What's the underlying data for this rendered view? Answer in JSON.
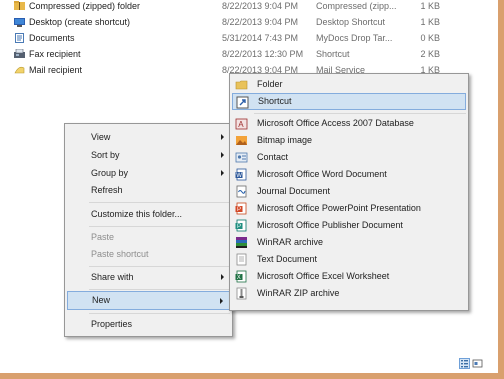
{
  "files": [
    {
      "name": "Compressed (zipped) folder",
      "date": "8/22/2013 9:04 PM",
      "type": "Compressed (zipp...",
      "size": "1 KB",
      "icon": "zip-folder-icon"
    },
    {
      "name": "Desktop (create shortcut)",
      "date": "8/22/2013 9:04 PM",
      "type": "Desktop Shortcut",
      "size": "1 KB",
      "icon": "desktop-icon"
    },
    {
      "name": "Documents",
      "date": "5/31/2014 7:43 PM",
      "type": "MyDocs Drop Tar...",
      "size": "0 KB",
      "icon": "document-icon"
    },
    {
      "name": "Fax recipient",
      "date": "8/22/2013 12:30 PM",
      "type": "Shortcut",
      "size": "2 KB",
      "icon": "fax-icon"
    },
    {
      "name": "Mail recipient",
      "date": "8/22/2013 9:04 PM",
      "type": "Mail Service",
      "size": "1 KB",
      "icon": "mail-icon"
    }
  ],
  "context_menu": {
    "view": "View",
    "sort_by": "Sort by",
    "group_by": "Group by",
    "refresh": "Refresh",
    "customize": "Customize this folder...",
    "paste": "Paste",
    "paste_shortcut": "Paste shortcut",
    "share_with": "Share with",
    "new": "New",
    "properties": "Properties"
  },
  "new_submenu": [
    {
      "label": "Folder",
      "icon": "folder-icon"
    },
    {
      "label": "Shortcut",
      "icon": "shortcut-icon"
    },
    {
      "label": "Microsoft Office Access 2007 Database",
      "icon": "access-icon"
    },
    {
      "label": "Bitmap image",
      "icon": "bitmap-icon"
    },
    {
      "label": "Contact",
      "icon": "contact-icon"
    },
    {
      "label": "Microsoft Office Word Document",
      "icon": "word-icon"
    },
    {
      "label": "Journal Document",
      "icon": "journal-icon"
    },
    {
      "label": "Microsoft Office PowerPoint Presentation",
      "icon": "powerpoint-icon"
    },
    {
      "label": "Microsoft Office Publisher Document",
      "icon": "publisher-icon"
    },
    {
      "label": "WinRAR archive",
      "icon": "winrar-icon"
    },
    {
      "label": "Text Document",
      "icon": "text-icon"
    },
    {
      "label": "Microsoft Office Excel Worksheet",
      "icon": "excel-icon"
    },
    {
      "label": "WinRAR ZIP archive",
      "icon": "winrar-zip-icon"
    }
  ],
  "colors": {
    "highlight": "#d1e2f2",
    "highlight_border": "#84acdd",
    "menu_bg": "#f0f0f0",
    "frame": "#d9a06e"
  },
  "view_buttons": [
    {
      "name": "details-view-icon",
      "active": true
    },
    {
      "name": "large-icons-view-icon",
      "active": false
    }
  ]
}
